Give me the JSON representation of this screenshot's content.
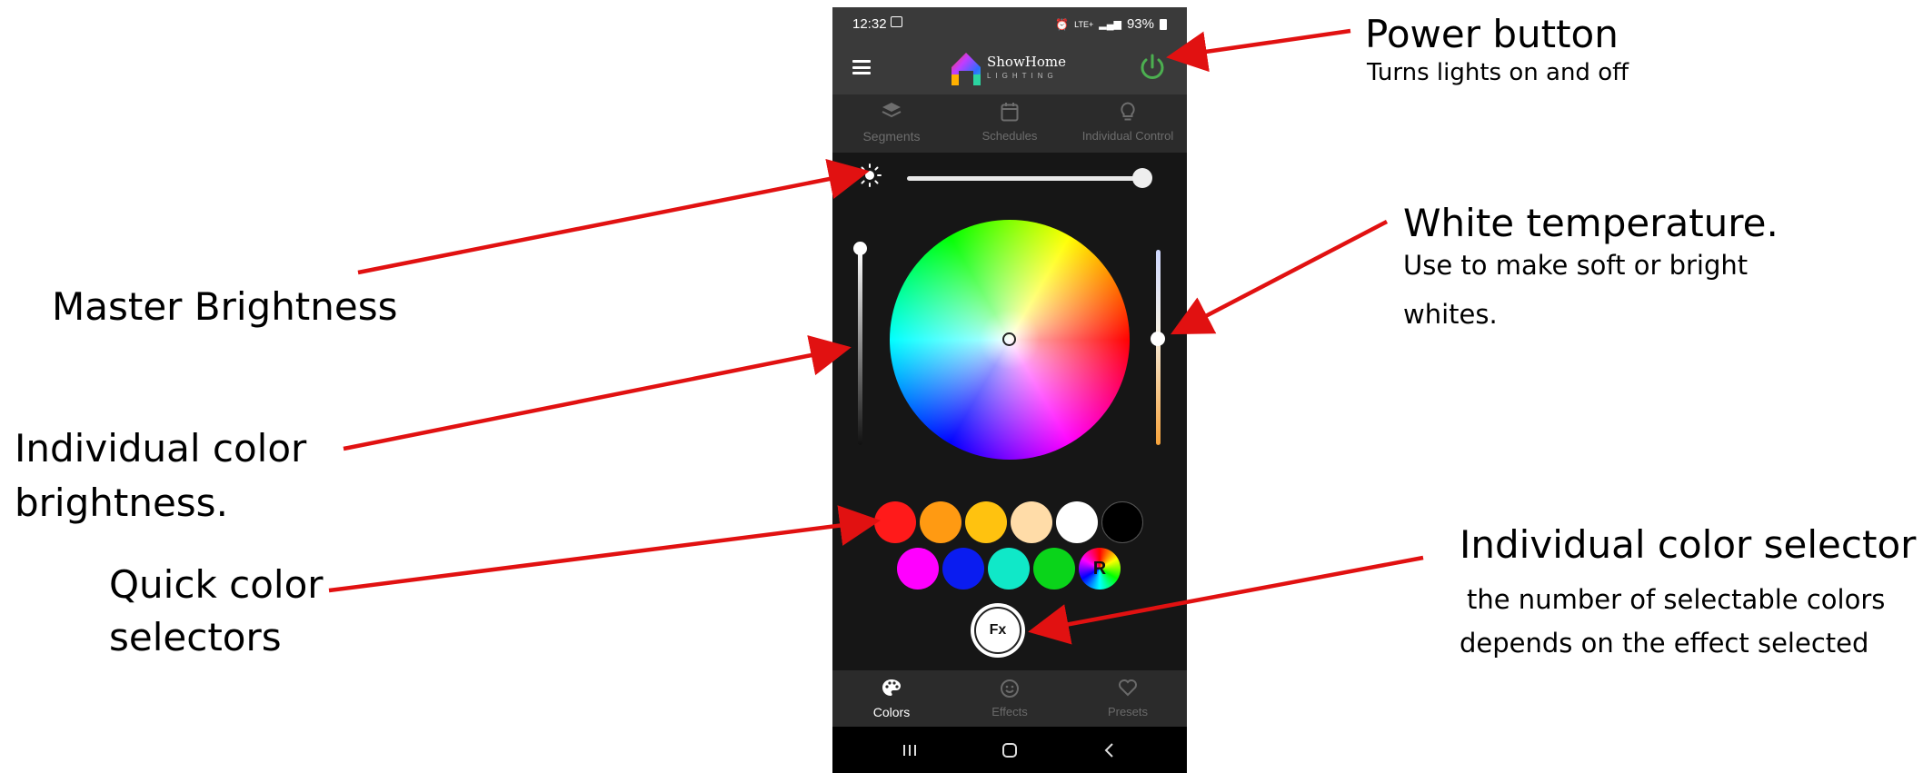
{
  "status_bar": {
    "time": "12:32",
    "network": "LTE+",
    "battery": "93%"
  },
  "app": {
    "name": "ShowHome",
    "subtitle": "LIGHTING"
  },
  "top_tabs": [
    {
      "label": "Segments"
    },
    {
      "label": "Schedules"
    },
    {
      "label": "Individual Control"
    }
  ],
  "master_brightness": {
    "value": 1.0
  },
  "individual_brightness": {
    "value": 1.0
  },
  "white_temperature": {
    "value": 0.48
  },
  "quick_colors": {
    "row1": [
      "#ff1a1a",
      "#ff9a12",
      "#ffc20f",
      "#ffdca8",
      "#ffffff",
      "#000000"
    ],
    "row2": [
      "#ff00ff",
      "#0a1cf0",
      "#10e8c8",
      "#0ad41a"
    ],
    "rainbow_label": "R"
  },
  "fx_button": {
    "label": "Fx"
  },
  "bottom_tabs": [
    {
      "label": "Colors",
      "active": true
    },
    {
      "label": "Effects",
      "active": false
    },
    {
      "label": "Presets",
      "active": false
    }
  ],
  "annotations": {
    "power_title": "Power button",
    "power_desc": "Turns lights on and off",
    "master_brightness": "Master Brightness",
    "white_temp_title": "White temperature.",
    "white_temp_desc_1": "Use to make soft or bright",
    "white_temp_desc_2": "whites.",
    "individual_brightness_1": "Individual color",
    "individual_brightness_2": "brightness.",
    "quick_colors_1": "Quick color",
    "quick_colors_2": "selectors",
    "color_selector_title": "Individual color selector",
    "color_selector_desc_1": "the number of selectable colors",
    "color_selector_desc_2": "depends on the effect selected"
  },
  "colors": {
    "arrow": "#e11111",
    "power": "#4caf50"
  }
}
